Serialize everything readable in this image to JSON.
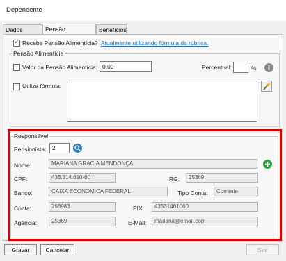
{
  "window": {
    "title": "Dependente"
  },
  "tabs": [
    {
      "label": "Dados Gerais"
    },
    {
      "label": "Pensão Alimentícia"
    },
    {
      "label": "Benefícios"
    }
  ],
  "pensao": {
    "recebe_label": "Recebe Pensão Alimentícia?",
    "recebe_checked": true,
    "formula_link": "Atualmente utilizando fórmula da rúbrica.",
    "group_title": "Pensão Alimentícia",
    "valor_label": "Valor da Pensão Alimentícia:",
    "valor_value": "0,00",
    "percentual_label": "Percentual:",
    "percent_symbol": "%",
    "utiliza_formula_label": "Utiliza fórmula:"
  },
  "responsavel": {
    "group_title": "Responsável",
    "pensionista_label": "Pensionista:",
    "pensionista_value": "2",
    "nome_label": "Nome:",
    "nome_value": "MARIANA GRACIA MENDONÇA",
    "cpf_label": "CPF:",
    "cpf_value": "435.314.610-60",
    "rg_label": "RG:",
    "rg_value": "25369",
    "banco_label": "Banco:",
    "banco_value": "CAIXA ECONOMICA FEDERAL",
    "tipo_conta_label": "Tipo Conta:",
    "tipo_conta_value": "Corrente",
    "conta_label": "Conta:",
    "conta_value": "256983",
    "pix_label": "PIX:",
    "pix_value": "43531461060",
    "agencia_label": "Agência:",
    "agencia_value": "25369",
    "email_label": "E-Mail:",
    "email_value": "mariana@email.com"
  },
  "buttons": {
    "gravar": "Gravar",
    "cancelar": "Cancelar",
    "sair": "Sair"
  },
  "icons": {
    "info": "info-icon",
    "formula_wand": "magic-wand-icon",
    "search": "search-icon",
    "add": "plus-icon"
  },
  "colors": {
    "highlight_frame": "#e00000",
    "link": "#1f6fb2",
    "add_button": "#2e9e3e",
    "search_button": "#2f7fc7"
  }
}
